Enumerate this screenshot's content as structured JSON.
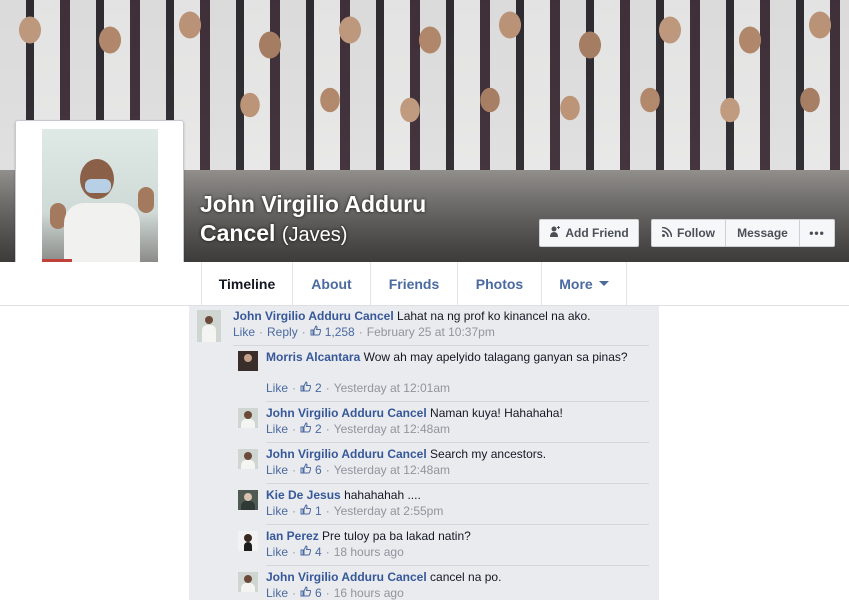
{
  "profile": {
    "name_line1": "John Virgilio Adduru",
    "name_line2": "Cancel",
    "alternate_name": "(Javes)"
  },
  "actions": {
    "add_friend": "Add Friend",
    "follow": "Follow",
    "message": "Message",
    "more": "•••"
  },
  "tabs": [
    {
      "label": "Timeline"
    },
    {
      "label": "About"
    },
    {
      "label": "Friends"
    },
    {
      "label": "Photos"
    },
    {
      "label": "More"
    }
  ],
  "post": {
    "author": "John Virgilio Adduru Cancel",
    "text": "Lahat na ng prof ko kinancel na ako.",
    "like": "Like",
    "reply": "Reply",
    "likes": "1,258",
    "time": "February 25 at 10:37pm"
  },
  "replies": [
    {
      "author": "Morris Alcantara",
      "text": "Wow ah may apelyido talagang ganyan sa",
      "text2": "pinas?",
      "like": "Like",
      "likes": "2",
      "time": "Yesterday at 12:01am"
    },
    {
      "author": "John Virgilio Adduru Cancel",
      "text": "Naman kuya! Hahahaha!",
      "like": "Like",
      "likes": "2",
      "time": "Yesterday at 12:48am"
    },
    {
      "author": "John Virgilio Adduru Cancel",
      "text": "Search my ancestors.",
      "like": "Like",
      "likes": "6",
      "time": "Yesterday at 12:48am"
    },
    {
      "author": "Kie De Jesus",
      "text": "hahahahah ....",
      "like": "Like",
      "likes": "1",
      "time": "Yesterday at 2:55pm"
    },
    {
      "author": "Ian Perez",
      "text": "Pre tuloy pa ba lakad natin?",
      "like": "Like",
      "likes": "4",
      "time": "18 hours ago"
    },
    {
      "author": "John Virgilio Adduru Cancel",
      "text": "cancel na po.",
      "like": "Like",
      "likes": "6",
      "time": "16 hours ago"
    }
  ],
  "icons": {
    "add_friend": "add-friend-icon",
    "follow": "rss-follow-icon",
    "like_thumb": "thumbs-up-icon",
    "more_caret": "chevron-down-icon"
  },
  "colors": {
    "link_blue": "#365899",
    "meta_gray": "#90949c",
    "comment_bg": "#e9ebee"
  }
}
